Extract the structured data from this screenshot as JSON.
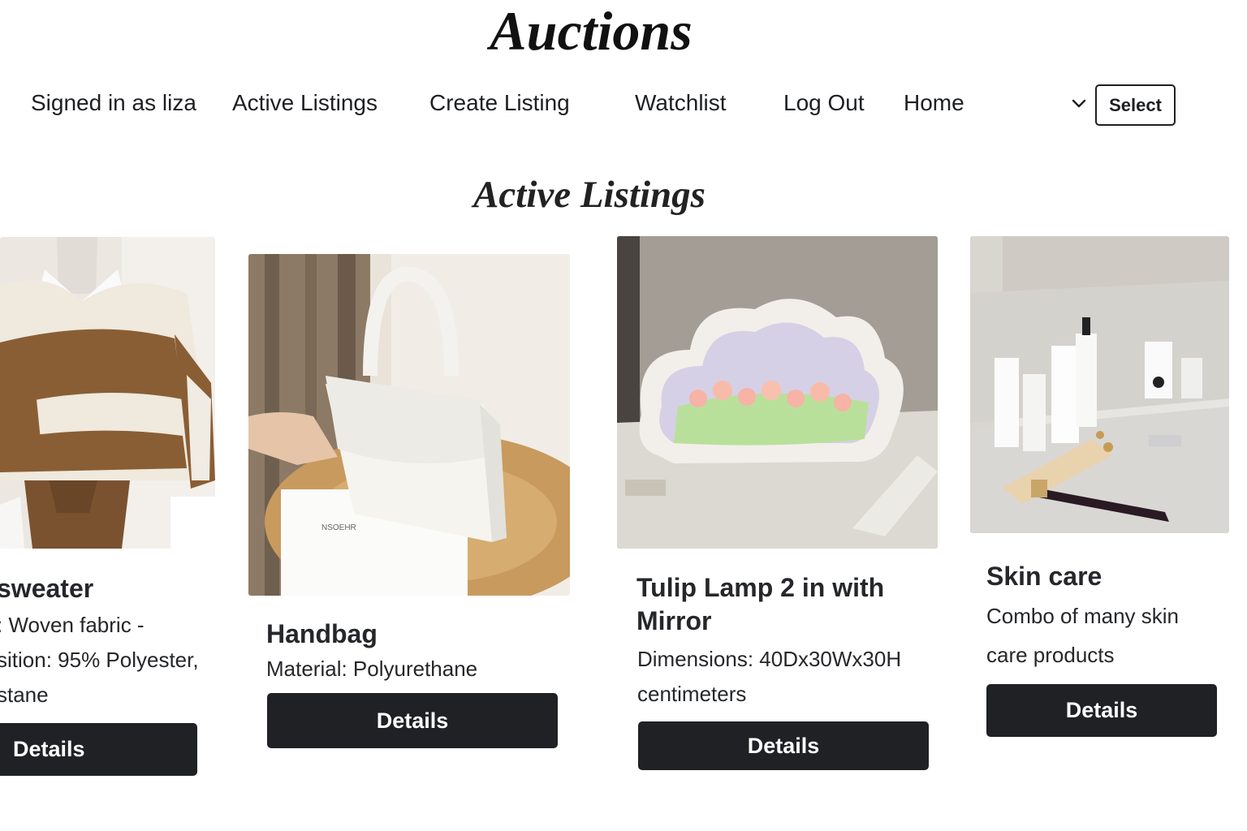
{
  "app": {
    "title": "Auctions"
  },
  "nav": {
    "signed_in": "Signed in as liza",
    "active_listings": "Active Listings",
    "create_listing": "Create Listing",
    "watchlist": "Watchlist",
    "log_out": "Log Out",
    "home": "Home",
    "dropdown_icon": "chevron-down-icon",
    "select_label": "Select"
  },
  "main": {
    "heading": "Active Listings",
    "listings": [
      {
        "title": "sweater",
        "description_lines": [
          ": Woven fabric -",
          "sition: 95% Polyester,",
          "stane"
        ],
        "button": "Details",
        "image": "striped sweater on mannequin"
      },
      {
        "title": "Handbag",
        "description_lines": [
          "Material: Polyurethane"
        ],
        "button": "Details",
        "image": "white handbag"
      },
      {
        "title_lines": [
          "Tulip Lamp 2 in with",
          "Mirror"
        ],
        "description_lines": [
          "Dimensions: 40Dx30Wx30H",
          "centimeters"
        ],
        "button": "Details",
        "image": "cloud tulip lamp"
      },
      {
        "title": "Skin care",
        "description_lines": [
          "Combo of many skin",
          "care products"
        ],
        "button": "Details",
        "image": "skin care bottles"
      }
    ]
  },
  "colors": {
    "button_bg": "#1f2124",
    "button_text": "#ffffff",
    "text": "#25272a"
  }
}
